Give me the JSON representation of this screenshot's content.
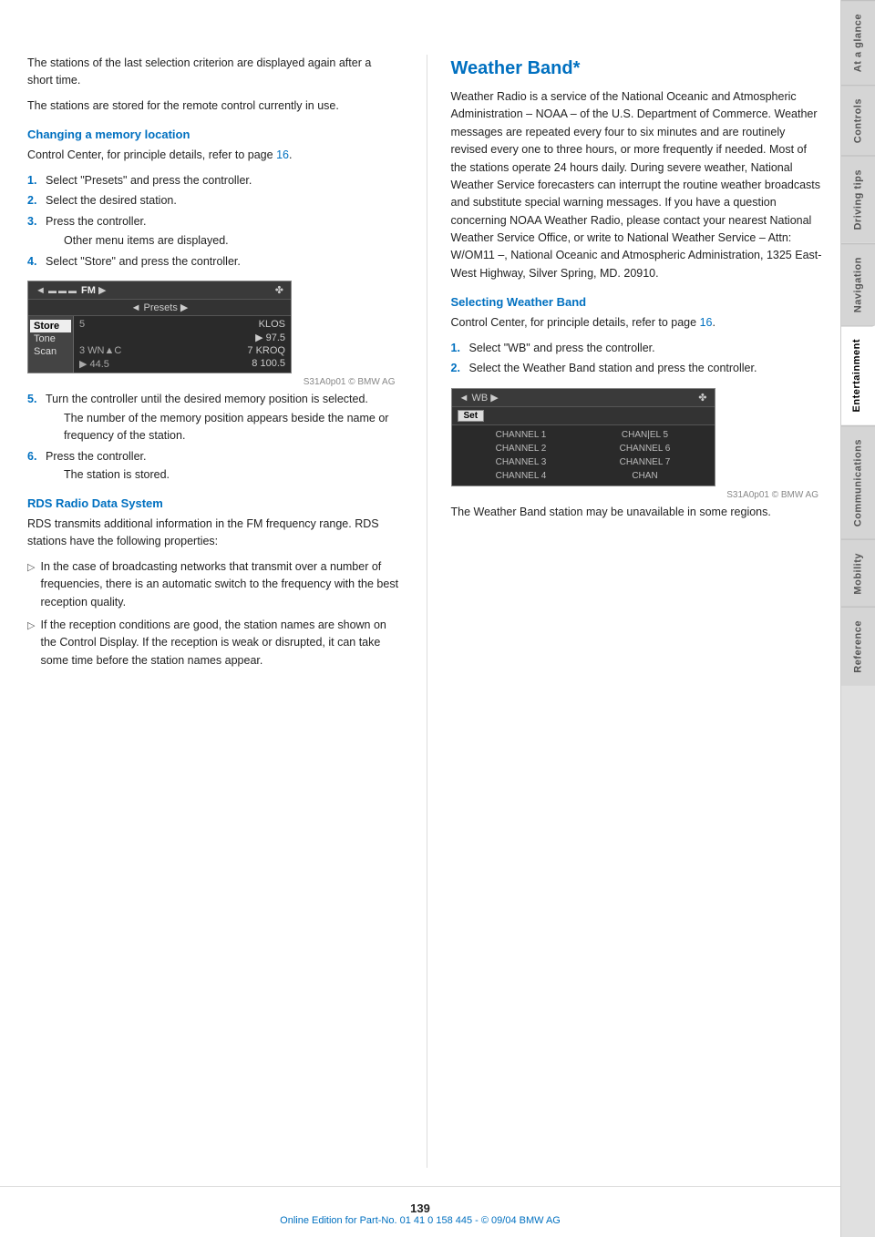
{
  "page": {
    "number": "139",
    "footer_note": "Online Edition for Part-No. 01 41 0 158 445 - © 09/04 BMW AG"
  },
  "tabs": [
    {
      "label": "At a glance",
      "active": false
    },
    {
      "label": "Controls",
      "active": false
    },
    {
      "label": "Driving tips",
      "active": false
    },
    {
      "label": "Navigation",
      "active": false
    },
    {
      "label": "Entertainment",
      "active": true
    },
    {
      "label": "Communications",
      "active": false
    },
    {
      "label": "Mobility",
      "active": false
    },
    {
      "label": "Reference",
      "active": false
    }
  ],
  "left_col": {
    "intro_text_1": "The stations of the last selection criterion are displayed again after a short time.",
    "intro_text_2": "The stations are stored for the remote control currently in use.",
    "section1": {
      "heading": "Changing a memory location",
      "intro": "Control Center, for principle details, refer to page 16.",
      "intro_link": "16",
      "steps": [
        {
          "num": "1.",
          "text": "Select \"Presets\" and press the controller."
        },
        {
          "num": "2.",
          "text": "Select the desired station."
        },
        {
          "num": "3.",
          "text": "Press the controller.",
          "sub": "Other menu items are displayed."
        },
        {
          "num": "4.",
          "text": "Select \"Store\" and press the controller."
        }
      ],
      "radio_display": {
        "top_left": "◄ ▬▬▬▬ FM ▶",
        "top_right": "✤",
        "presets": "◄ Presets ▶",
        "menu_items": [
          "Store",
          "Tone",
          "Scan"
        ],
        "selected_menu": "Store",
        "stations": [
          {
            "num": "5",
            "name": "KLOS"
          },
          {
            "num": "",
            "name": "▶ 97.5"
          },
          {
            "num": "3 WN",
            "name": "C    7 KROQ"
          },
          {
            "num": "",
            "name": "▶ 44.5    8 100.5"
          }
        ]
      },
      "steps2": [
        {
          "num": "5.",
          "text": "Turn the controller until the desired memory position is selected.",
          "sub": "The number of the memory position appears beside the name or frequency of the station."
        },
        {
          "num": "6.",
          "text": "Press the controller.",
          "sub": "The station is stored."
        }
      ]
    },
    "section2": {
      "heading": "RDS Radio Data System",
      "intro": "RDS transmits additional information in the FM frequency range. RDS stations have the following properties:",
      "bullets": [
        "In the case of broadcasting networks that transmit over a number of frequencies, there is an automatic switch to the frequency with the best reception quality.",
        "If the reception conditions are good, the station names are shown on the Control Display. If the reception is weak or disrupted, it can take some time before the station names appear."
      ]
    }
  },
  "right_col": {
    "heading": "Weather Band*",
    "intro": "Weather Radio is a service of the National Oceanic and Atmospheric Administration – NOAA – of the U.S. Department of Commerce. Weather messages are repeated every four to six minutes and are routinely revised every one to three hours, or more frequently if needed. Most of the stations operate 24 hours daily. During severe weather, National Weather Service forecasters can interrupt the routine weather broadcasts and substitute special warning messages. If you have a question concerning NOAA Weather Radio, please contact your nearest National Weather Service Office, or write to National Weather Service – Attn: W/OM11 –, National Oceanic and Atmospheric Administration, 1325 East-West Highway, Silver Spring, MD. 20910.",
    "section1": {
      "heading": "Selecting Weather Band",
      "intro": "Control Center, for principle details, refer to page 16.",
      "intro_link": "16",
      "steps": [
        {
          "num": "1.",
          "text": "Select \"WB\" and press the controller."
        },
        {
          "num": "2.",
          "text": "Select the Weather Band station and press the controller."
        }
      ],
      "wb_display": {
        "top_label": "◄ WB ▶",
        "top_right": "✤",
        "set_label": "Set",
        "channels": [
          [
            "CHANNEL 1",
            "CHANNEL 5"
          ],
          [
            "CHANNEL 2",
            "CHANNEL 6"
          ],
          [
            "CHANNEL 3",
            "CHANNEL 7"
          ],
          [
            "CHANNEL 4",
            "CHAN"
          ]
        ]
      },
      "footer_text": "The Weather Band station may be unavailable in some regions."
    }
  }
}
